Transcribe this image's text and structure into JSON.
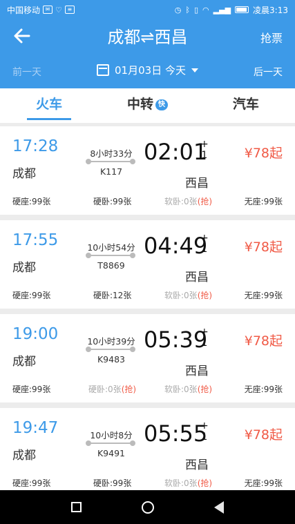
{
  "status_bar": {
    "carrier": "中国移动",
    "time": "凌晨3:13"
  },
  "header": {
    "title": "成都⇌西昌",
    "grab_label": "抢票"
  },
  "date_bar": {
    "prev_label": "前一天",
    "date": "01月03日 今天",
    "next_label": "后一天"
  },
  "tabs": [
    {
      "label": "火车",
      "active": true
    },
    {
      "label": "中转",
      "badge": "快"
    },
    {
      "label": "汽车"
    }
  ],
  "trains": [
    {
      "dep_time": "17:28",
      "dep_station": "成都",
      "duration": "8小时33分",
      "train_no": "K117",
      "arr_time": "02:01",
      "day_plus_top": "+",
      "day_plus_bottom": "1",
      "arr_station": "西昌",
      "price": "¥78起",
      "seats": [
        {
          "label": "硬座:99张"
        },
        {
          "label": "硬卧:99张"
        },
        {
          "label": "软卧:0张",
          "grab": "(抢)"
        },
        {
          "label": "无座:99张"
        }
      ]
    },
    {
      "dep_time": "17:55",
      "dep_station": "成都",
      "duration": "10小时54分",
      "train_no": "T8869",
      "arr_time": "04:49",
      "day_plus_top": "+",
      "day_plus_bottom": "1",
      "arr_station": "西昌",
      "price": "¥78起",
      "seats": [
        {
          "label": "硬座:99张"
        },
        {
          "label": "硬卧:12张"
        },
        {
          "label": "软卧:0张",
          "grab": "(抢)"
        },
        {
          "label": "无座:99张"
        }
      ]
    },
    {
      "dep_time": "19:00",
      "dep_station": "成都",
      "duration": "10小时39分",
      "train_no": "K9483",
      "arr_time": "05:39",
      "day_plus_top": "+",
      "day_plus_bottom": "1",
      "arr_station": "西昌",
      "price": "¥78起",
      "seats": [
        {
          "label": "硬座:99张"
        },
        {
          "label": "硬卧:0张",
          "grab": "(抢)"
        },
        {
          "label": "软卧:0张",
          "grab": "(抢)"
        },
        {
          "label": "无座:99张"
        }
      ]
    },
    {
      "dep_time": "19:47",
      "dep_station": "成都",
      "duration": "10小时8分",
      "train_no": "K9491",
      "arr_time": "05:55",
      "day_plus_top": "+",
      "day_plus_bottom": "1",
      "arr_station": "西昌",
      "price": "¥78起",
      "seats": [
        {
          "label": "硬座:99张"
        },
        {
          "label": "硬卧:99张"
        },
        {
          "label": "软卧:0张",
          "grab": "(抢)"
        },
        {
          "label": "无座:99张"
        }
      ]
    }
  ],
  "colors": {
    "primary": "#3d9ae8",
    "price": "#f05a46"
  }
}
